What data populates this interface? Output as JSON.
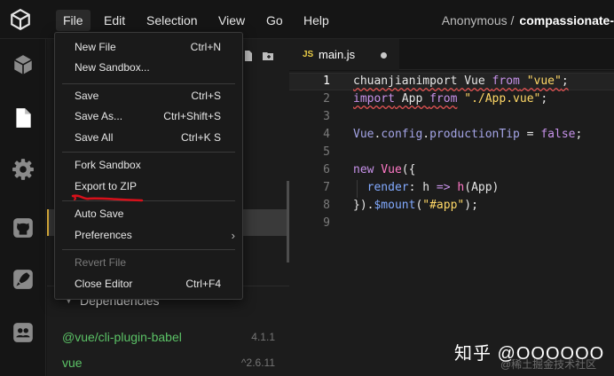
{
  "colors": {
    "background": "#151515",
    "sidebar": "#1c1c1c",
    "dependency_green": "#5bc266",
    "accent_yellow": "#e2b43c",
    "keyword_purple": "#c792ea",
    "string_yellow": "#ffd866",
    "error_red": "#e05252"
  },
  "menubar": {
    "items": [
      {
        "label": "File",
        "active": true
      },
      {
        "label": "Edit"
      },
      {
        "label": "Selection"
      },
      {
        "label": "View"
      },
      {
        "label": "Go"
      },
      {
        "label": "Help"
      }
    ],
    "user": "Anonymous /",
    "project": "compassionate-"
  },
  "activity_icons": [
    "cube-icon",
    "file-icon",
    "gear-icon",
    "github-icon",
    "rocket-icon",
    "users-icon"
  ],
  "sidebar": {
    "dependencies_label": "Dependencies",
    "dependencies": [
      {
        "name": "@vue/cli-plugin-babel",
        "version": "4.1.1"
      },
      {
        "name": "vue",
        "version": "^2.6.11"
      }
    ]
  },
  "editor": {
    "tab": {
      "icon": "JS",
      "name": "main.js",
      "modified": true
    },
    "line_numbers": [
      "1",
      "2",
      "3",
      "4",
      "5",
      "6",
      "7",
      "8",
      "9"
    ],
    "current_line": "1",
    "lines": {
      "l1": {
        "prefix": "chuanjianimport",
        "mid": " Vue ",
        "from": "from",
        "str": "\"vue\"",
        "end": ";"
      },
      "l2": {
        "kw": "import",
        "mid": " App ",
        "from": "from",
        "str": "\"./App.vue\"",
        "end": ";"
      },
      "l4": {
        "obj": "Vue",
        "dot1": ".",
        "p1": "config",
        "dot2": ".",
        "p2": "productionTip",
        "eq": " = ",
        "val": "false",
        "end": ";"
      },
      "l6": {
        "kw": "new",
        "cls": " Vue",
        "end": "({"
      },
      "l7": {
        "prop": "render",
        "colon": ": ",
        "arg": "h",
        "arrow": " => ",
        "fn": "h",
        "call": "(App)"
      },
      "l8": {
        "close": "}).",
        "fn": "$mount",
        "open": "(",
        "str": "\"#app\"",
        "end": ");"
      }
    }
  },
  "file_menu": {
    "items": [
      {
        "label": "New File",
        "shortcut": "Ctrl+N"
      },
      {
        "label": "New Sandbox...",
        "shortcut": ""
      },
      {
        "label": "Save",
        "shortcut": "Ctrl+S"
      },
      {
        "label": "Save As...",
        "shortcut": "Ctrl+Shift+S"
      },
      {
        "label": "Save All",
        "shortcut": "Ctrl+K S"
      },
      {
        "label": "Fork Sandbox",
        "shortcut": ""
      },
      {
        "label": "Export to ZIP",
        "shortcut": ""
      },
      {
        "label": "Auto Save",
        "shortcut": ""
      },
      {
        "label": "Preferences",
        "shortcut": "",
        "submenu": true
      },
      {
        "label": "Revert File",
        "shortcut": "",
        "disabled": true
      },
      {
        "label": "Close Editor",
        "shortcut": "Ctrl+F4"
      }
    ]
  },
  "watermark": {
    "text": "知乎 @OOOOOO",
    "sub": "@稀土掘金技术社区"
  }
}
